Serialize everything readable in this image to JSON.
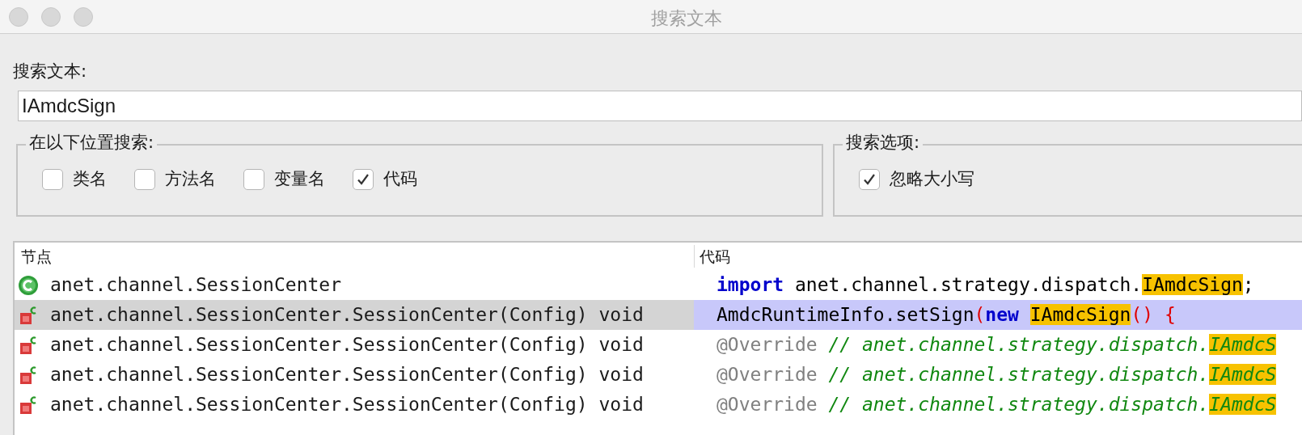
{
  "window": {
    "title": "搜索文本"
  },
  "search": {
    "label": "搜索文本:",
    "value": "IAmdcSign"
  },
  "location_group": {
    "title": "在以下位置搜索:",
    "options": [
      {
        "label": "类名",
        "checked": false
      },
      {
        "label": "方法名",
        "checked": false
      },
      {
        "label": "变量名",
        "checked": false
      },
      {
        "label": "代码",
        "checked": true
      }
    ]
  },
  "options_group": {
    "title": "搜索选项:",
    "options": [
      {
        "label": "忽略大小写",
        "checked": true
      }
    ]
  },
  "table": {
    "columns": [
      "节点",
      "代码"
    ],
    "rows": [
      {
        "kind": "class",
        "node": "anet.channel.SessionCenter",
        "selected": false,
        "code": [
          {
            "kind": "keyword",
            "text": "import"
          },
          {
            "kind": "plain",
            "text": " anet.channel.strategy.dispatch."
          },
          {
            "kind": "match",
            "text": "IAmdcSign"
          },
          {
            "kind": "plain",
            "text": ";"
          }
        ]
      },
      {
        "kind": "method",
        "node": "anet.channel.SessionCenter.SessionCenter(Config) void",
        "selected": true,
        "code": [
          {
            "kind": "plain",
            "text": "AmdcRuntimeInfo.setSign"
          },
          {
            "kind": "punct",
            "text": "("
          },
          {
            "kind": "keyword",
            "text": "new "
          },
          {
            "kind": "match",
            "text": "IAmdcSign"
          },
          {
            "kind": "punct",
            "text": "() {"
          }
        ]
      },
      {
        "kind": "method",
        "node": "anet.channel.SessionCenter.SessionCenter(Config) void",
        "selected": false,
        "code": [
          {
            "kind": "annotation",
            "text": "@Override"
          },
          {
            "kind": "comment",
            "text": " // anet.channel.strategy.dispatch."
          },
          {
            "kind": "match_comment",
            "text": "IAmdcS"
          }
        ]
      },
      {
        "kind": "method",
        "node": "anet.channel.SessionCenter.SessionCenter(Config) void",
        "selected": false,
        "code": [
          {
            "kind": "annotation",
            "text": "@Override"
          },
          {
            "kind": "comment",
            "text": " // anet.channel.strategy.dispatch."
          },
          {
            "kind": "match_comment",
            "text": "IAmdcS"
          }
        ]
      },
      {
        "kind": "method",
        "node": "anet.channel.SessionCenter.SessionCenter(Config) void",
        "selected": false,
        "code": [
          {
            "kind": "annotation",
            "text": "@Override"
          },
          {
            "kind": "comment",
            "text": " // anet.channel.strategy.dispatch."
          },
          {
            "kind": "match_comment",
            "text": "IAmdcS"
          }
        ]
      }
    ]
  }
}
